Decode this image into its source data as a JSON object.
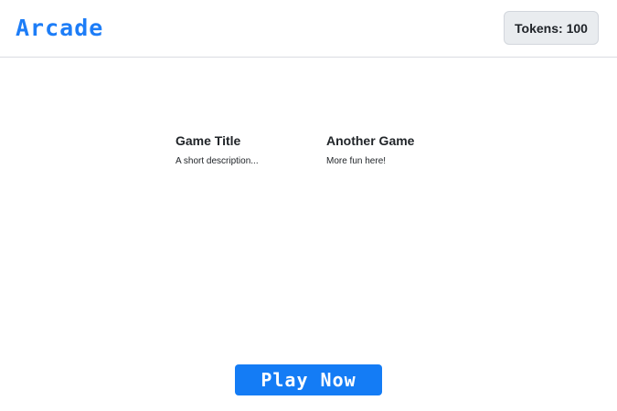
{
  "header": {
    "logo_text": "Arcade",
    "tokens_label": "Tokens: 100"
  },
  "games": [
    {
      "title": "Game Title",
      "description": "A short description..."
    },
    {
      "title": "Another Game",
      "description": "More fun here!"
    }
  ],
  "cta": {
    "label": "Play Now"
  },
  "colors": {
    "brand": "#1d7df7",
    "button": "#147cf5",
    "token_bg": "#e9ecef"
  }
}
